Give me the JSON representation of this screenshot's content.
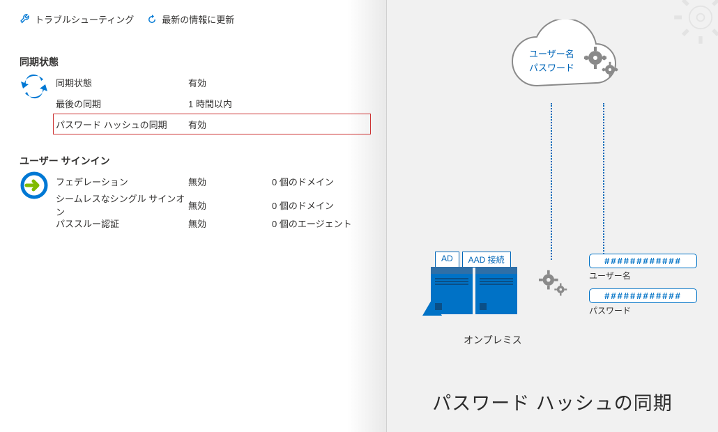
{
  "toolbar": {
    "troubleshoot": "トラブルシューティング",
    "refresh": "最新の情報に更新"
  },
  "sections": {
    "sync": {
      "title": "同期状態",
      "rows": [
        {
          "label": "同期状態",
          "value": "有効"
        },
        {
          "label": "最後の同期",
          "value": "1 時間以内"
        },
        {
          "label": "パスワード ハッシュの同期",
          "value": "有効",
          "highlighted": true
        }
      ]
    },
    "signin": {
      "title": "ユーザー サインイン",
      "rows": [
        {
          "label": "フェデレーション",
          "value": "無効",
          "extra": "0 個のドメイン",
          "link": true
        },
        {
          "label": "シームレスなシングル サインオン",
          "value": "無効",
          "extra": "0 個のドメイン",
          "link": true
        },
        {
          "label": "パススルー認証",
          "value": "無効",
          "extra": "0 個のエージェント",
          "link": true
        }
      ]
    }
  },
  "diagram": {
    "cloud_user": "ユーザー名",
    "cloud_pass": "パスワード",
    "server_tag_ad": "AD",
    "server_tag_aad": "AAD 接続",
    "onprem_caption": "オンプレミス",
    "hash_value": "############",
    "hash_user_label": "ユーザー名",
    "hash_pass_label": "パスワード",
    "big_caption": "パスワード ハッシュの同期"
  }
}
